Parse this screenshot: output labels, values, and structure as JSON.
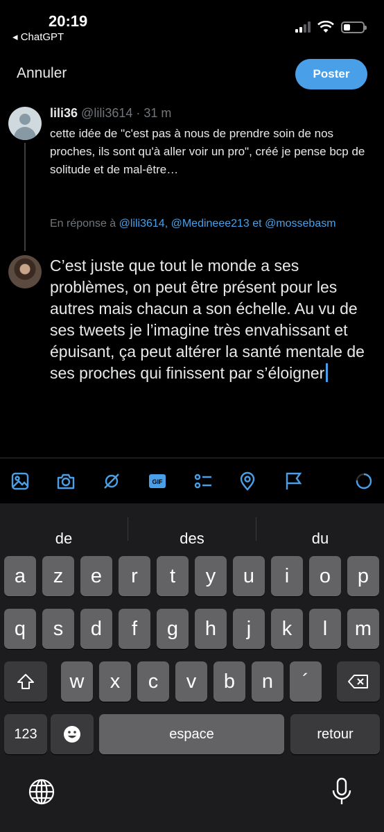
{
  "status_bar": {
    "time": "20:19",
    "back_app": "◂ ChatGPT",
    "battery_level": 0.35
  },
  "header": {
    "cancel_label": "Annuler",
    "post_label": "Poster"
  },
  "tweet": {
    "name": "lili36",
    "handle": "@lili3614",
    "separator": "·",
    "time": "31 m",
    "text": "cette idée de \"c'est pas à nous de prendre soin de nos proches, ils sont qu'à aller voir un pro\", créé je pense bcp de solitude et de mal-être…"
  },
  "reply": {
    "prefix": "En réponse à",
    "mention_1": "@lili3614,",
    "mention_2": "@Medineee213",
    "conjunction": "et",
    "mention_3": "@mossebasm"
  },
  "compose": {
    "text": "C’est juste que tout le monde a ses problèmes, on peut être présent pour les autres mais chacun a son échelle. Au vu de ses tweets je l’imagine très envahissant et épuisant, ça peut altérer la santé mentale de ses proches qui finissent par s’éloigner"
  },
  "toolbar": {
    "icons": [
      "image-icon",
      "camera-icon",
      "grok-icon",
      "gif-icon",
      "poll-icon",
      "location-icon",
      "flag-icon",
      "progress-ring-icon"
    ],
    "gif_label": "GIF",
    "accent": "#4aa0e8"
  },
  "keyboard": {
    "suggestions": [
      "de",
      "des",
      "du"
    ],
    "row1": [
      "a",
      "z",
      "e",
      "r",
      "t",
      "y",
      "u",
      "i",
      "o",
      "p"
    ],
    "row2": [
      "q",
      "s",
      "d",
      "f",
      "g",
      "h",
      "j",
      "k",
      "l",
      "m"
    ],
    "row3": [
      "w",
      "x",
      "c",
      "v",
      "b",
      "n",
      "´"
    ],
    "numbers_label": "123",
    "space_label": "espace",
    "return_label": "retour"
  }
}
